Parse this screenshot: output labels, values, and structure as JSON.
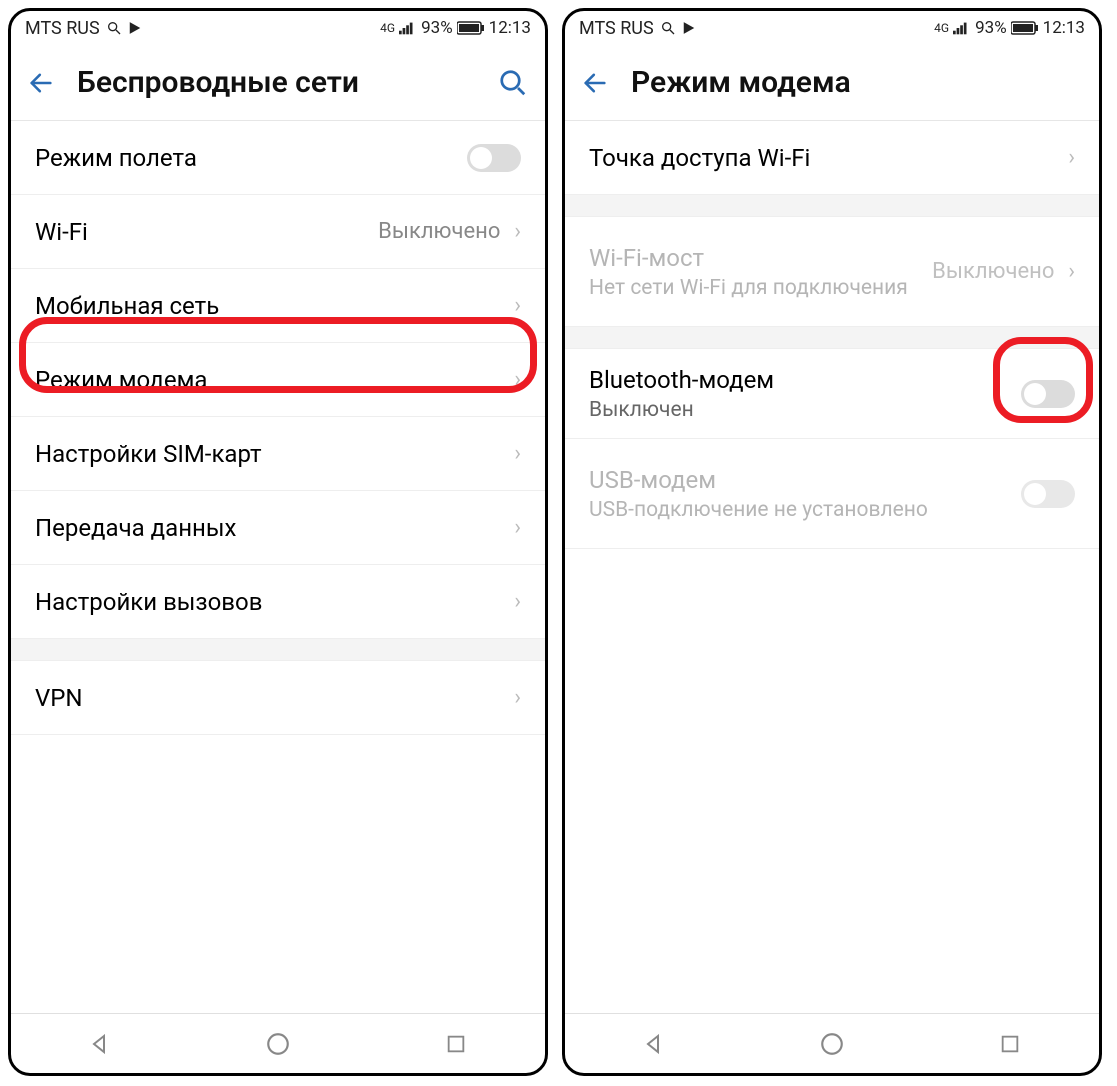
{
  "statusbar": {
    "carrier": "MTS RUS",
    "network": "4G",
    "battery": "93%",
    "time": "12:13"
  },
  "left": {
    "title": "Беспроводные сети",
    "items": {
      "airplane": "Режим полета",
      "wifi": "Wi-Fi",
      "wifi_value": "Выключено",
      "mobile": "Мобильная сеть",
      "tether": "Режим модема",
      "sim": "Настройки SIM-карт",
      "data": "Передача данных",
      "calls": "Настройки вызовов",
      "vpn": "VPN"
    }
  },
  "right": {
    "title": "Режим модема",
    "items": {
      "hotspot": "Точка доступа Wi-Fi",
      "bridge": "Wi-Fi-мост",
      "bridge_sub": "Нет сети Wi-Fi для подключения",
      "bridge_value": "Выключено",
      "bt": "Bluetooth-модем",
      "bt_sub": "Выключен",
      "usb": "USB-модем",
      "usb_sub": "USB-подключение не установлено"
    }
  }
}
